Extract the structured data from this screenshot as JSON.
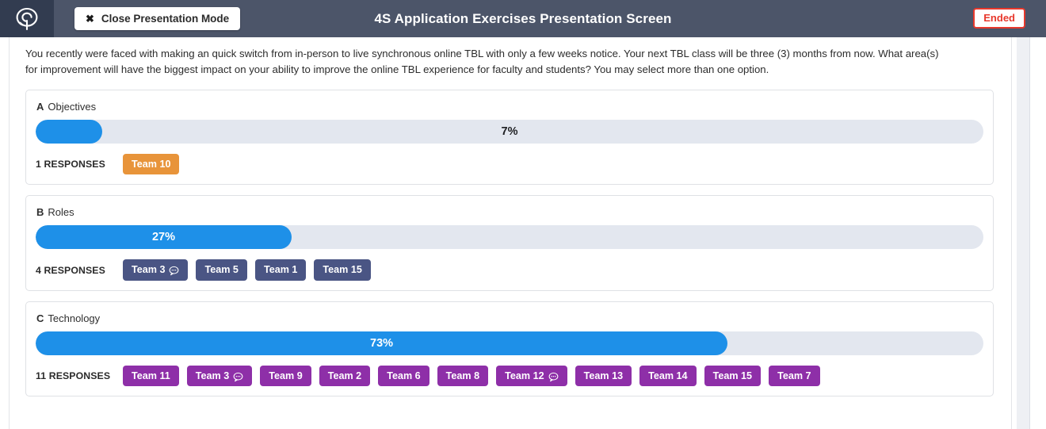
{
  "topbar": {
    "logo_icon": "pin-spiral-logo-icon",
    "close_presentation_label": "Close Presentation Mode",
    "close_icon": "close-x-icon",
    "title": "4S Application Exercises Presentation Screen",
    "status_badge": "Ended",
    "colors": {
      "bar_bg": "#4c5569",
      "logo_bg": "#323c50",
      "status_red": "#e8382c"
    }
  },
  "question": {
    "prompt": "You recently were faced with making an quick switch from in-person to live synchronous online TBL with only a few weeks notice. Your next TBL class will be three (3) months from now. What area(s) for improvement will have the biggest impact on your ability to improve the online TBL experience for faculty and students?  You may select more than one option."
  },
  "chart_data": {
    "type": "bar",
    "title": "",
    "xlabel": "",
    "ylabel": "",
    "xlim": [
      0,
      100
    ],
    "grid": false,
    "legend": "none",
    "categories": [
      "A Objectives",
      "B Roles",
      "C Technology"
    ],
    "values": [
      7,
      27,
      73
    ],
    "value_labels": [
      "7%",
      "27%",
      "73%"
    ],
    "response_counts": [
      1,
      4,
      11
    ]
  },
  "options": [
    {
      "letter": "A",
      "label": "Objectives",
      "percent": 7,
      "percent_label": "7%",
      "responses_label": "1 RESPONSES",
      "bar_color": "#1e90e8",
      "label_on_fill": false,
      "badge_color": "#e8943a",
      "teams": [
        {
          "name": "Team 10",
          "comment": false
        }
      ]
    },
    {
      "letter": "B",
      "label": "Roles",
      "percent": 27,
      "percent_label": "27%",
      "responses_label": "4 RESPONSES",
      "bar_color": "#1e90e8",
      "label_on_fill": true,
      "badge_color": "#4a5584",
      "teams": [
        {
          "name": "Team 3",
          "comment": true
        },
        {
          "name": "Team 5",
          "comment": false
        },
        {
          "name": "Team 1",
          "comment": false
        },
        {
          "name": "Team 15",
          "comment": false
        }
      ]
    },
    {
      "letter": "C",
      "label": "Technology",
      "percent": 73,
      "percent_label": "73%",
      "responses_label": "11 RESPONSES",
      "bar_color": "#1e90e8",
      "label_on_fill": true,
      "badge_color": "#8e2fa8",
      "teams": [
        {
          "name": "Team 11",
          "comment": false
        },
        {
          "name": "Team 3",
          "comment": true
        },
        {
          "name": "Team 9",
          "comment": false
        },
        {
          "name": "Team 2",
          "comment": false
        },
        {
          "name": "Team 6",
          "comment": false
        },
        {
          "name": "Team 8",
          "comment": false
        },
        {
          "name": "Team 12",
          "comment": true
        },
        {
          "name": "Team 13",
          "comment": false
        },
        {
          "name": "Team 14",
          "comment": false
        },
        {
          "name": "Team 15",
          "comment": false
        },
        {
          "name": "Team 7",
          "comment": false
        }
      ]
    }
  ]
}
